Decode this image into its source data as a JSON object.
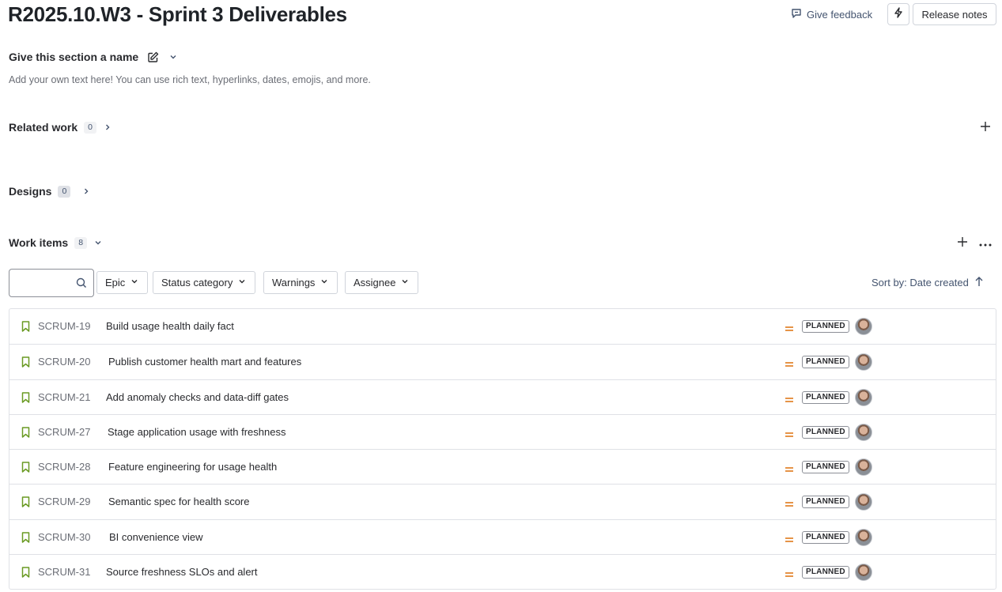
{
  "header": {
    "title": "R2025.10.W3 - Sprint 3 Deliverables",
    "feedback_label": "Give feedback",
    "release_notes_label": "Release notes"
  },
  "section": {
    "name_label": "Give this section a name",
    "description": "Add your own text here! You can use rich text, hyperlinks, dates, emojis, and more."
  },
  "related_work": {
    "label": "Related work",
    "count": "0"
  },
  "designs": {
    "label": "Designs",
    "count": "0"
  },
  "work_items": {
    "label": "Work items",
    "count": "8",
    "search_placeholder": "",
    "filters": {
      "epic": "Epic",
      "status_category": "Status category",
      "warnings": "Warnings",
      "assignee": "Assignee"
    },
    "sort_label": "Sort by: Date created",
    "rows": [
      {
        "key": "SCRUM-19",
        "summary": "Build usage health daily fact",
        "status": "PLANNED"
      },
      {
        "key": "SCRUM-20",
        "summary": "Publish customer health mart and features",
        "status": "PLANNED"
      },
      {
        "key": "SCRUM-21",
        "summary": "Add anomaly checks and data-diff gates",
        "status": "PLANNED"
      },
      {
        "key": "SCRUM-27",
        "summary": "Stage application usage with freshness",
        "status": "PLANNED"
      },
      {
        "key": "SCRUM-28",
        "summary": "Feature engineering for usage health",
        "status": "PLANNED"
      },
      {
        "key": "SCRUM-29",
        "summary": "Semantic spec for health score",
        "status": "PLANNED"
      },
      {
        "key": "SCRUM-30",
        "summary": "BI convenience view",
        "status": "PLANNED"
      },
      {
        "key": "SCRUM-31",
        "summary": "Source freshness SLOs and alert",
        "status": "PLANNED"
      }
    ]
  },
  "colors": {
    "story_icon": "#6a9a23",
    "priority_medium": "#e2852f",
    "text_primary": "#292a2e",
    "text_subtle": "#6b6e76",
    "border": "#dfe1e6"
  },
  "icons": {
    "feedback": "speech-bubble-icon",
    "automation": "lightning-bolt-icon",
    "edit": "pencil-square-icon",
    "expand": "chevron-right-icon",
    "collapse": "chevron-down-icon",
    "add": "plus-icon",
    "more": "ellipsis-icon",
    "search": "magnifier-icon",
    "sort": "arrow-up-icon",
    "story": "bookmark-icon",
    "priority": "equals-icon"
  }
}
